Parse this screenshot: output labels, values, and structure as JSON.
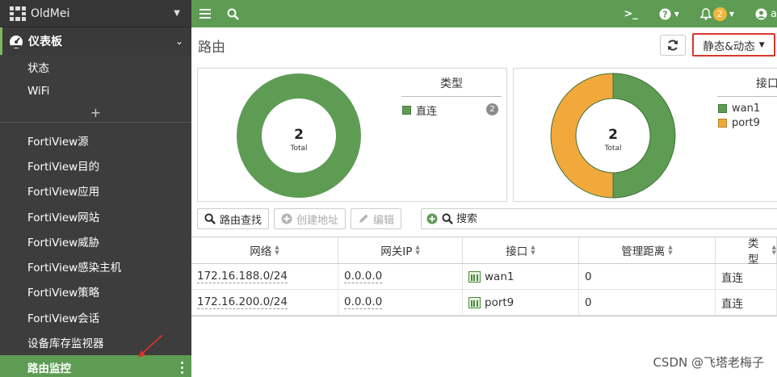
{
  "sidebar": {
    "header_title": "OldMei",
    "dashboard_label": "仪表板",
    "sub_items": [
      "状态",
      "WiFi"
    ],
    "add_symbol": "+",
    "items": [
      "FortiView源",
      "FortiView目的",
      "FortiView应用",
      "FortiView网站",
      "FortiView威胁",
      "FortiView感染主机",
      "FortiView策略",
      "FortiView会话",
      "设备库存监视器",
      "路由监控"
    ],
    "active_item": "路由监控"
  },
  "topbar": {
    "notification_count": "2",
    "user_initial": "a"
  },
  "page": {
    "title": "路由",
    "mode_button": "静态&动态"
  },
  "charts": {
    "type_chart": {
      "center_value": "2",
      "center_label": "Total",
      "legend_title": "类型",
      "legend": [
        {
          "name": "直连",
          "count": "2",
          "color": "#5e9c54"
        }
      ]
    },
    "interface_chart": {
      "center_value": "2",
      "center_label": "Total",
      "legend_title": "接口",
      "legend": [
        {
          "name": "wan1",
          "color": "#5e9c54"
        },
        {
          "name": "port9",
          "color": "#f2a93b"
        }
      ]
    }
  },
  "chart_data": [
    {
      "type": "pie",
      "categories": [
        "直连"
      ],
      "values": [
        2
      ],
      "title": "类型"
    },
    {
      "type": "pie",
      "categories": [
        "wan1",
        "port9"
      ],
      "values": [
        1,
        1
      ],
      "title": "接口"
    }
  ],
  "toolbar": {
    "route_lookup": "路由查找",
    "create_address": "创建地址",
    "edit": "编辑",
    "search_placeholder": "搜索"
  },
  "table": {
    "columns": [
      "网络",
      "网关IP",
      "接口",
      "管理距离",
      "类型"
    ],
    "rows": [
      {
        "network": "172.16.188.0/24",
        "gateway": "0.0.0.0",
        "interface": "wan1",
        "distance": "0",
        "type": "直连"
      },
      {
        "network": "172.16.200.0/24",
        "gateway": "0.0.0.0",
        "interface": "port9",
        "distance": "0",
        "type": "直连"
      }
    ]
  },
  "watermark": "CSDN @飞塔老梅子"
}
